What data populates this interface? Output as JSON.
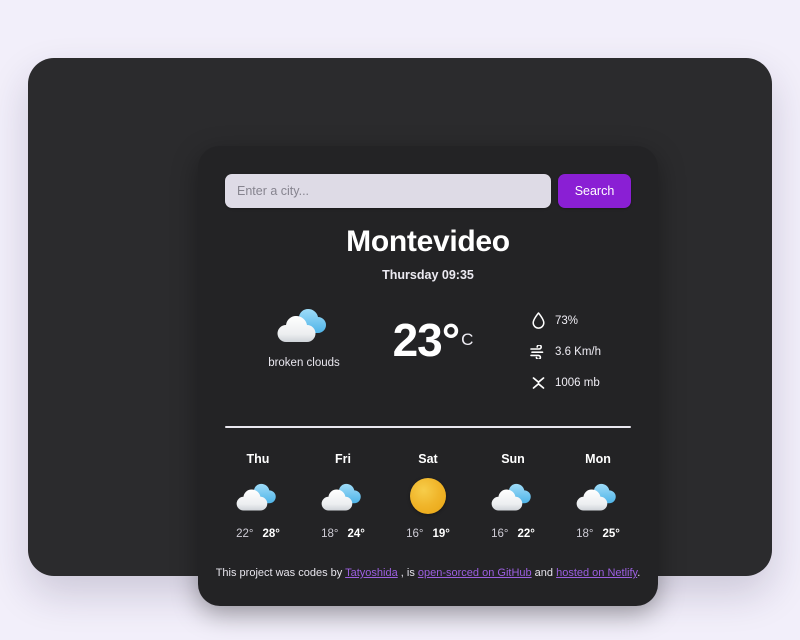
{
  "theme": {
    "page_background": "#f2effa",
    "outer_card": "#2b2b2d",
    "inner_card": "#232325",
    "accent_purple": "#8a1fd4",
    "link_purple": "#9c5fe0",
    "sun_yellow": "#f0b52a",
    "cloud_blue": "#7ec8f0",
    "text_primary": "#ffffff"
  },
  "search": {
    "placeholder": "Enter a city...",
    "value": "",
    "button_label": "Search"
  },
  "current": {
    "city": "Montevideo",
    "datetime": "Thursday 09:35",
    "icon": "broken-clouds-icon",
    "description": "broken clouds",
    "temperature": "23°",
    "unit": "C",
    "stats": [
      {
        "icon": "humidity-droplet-icon",
        "value": "73%"
      },
      {
        "icon": "wind-icon",
        "value": "3.6 Km/h"
      },
      {
        "icon": "pressure-icon",
        "value": "1006 mb"
      }
    ]
  },
  "forecast": [
    {
      "day": "Thu",
      "icon": "broken-clouds-icon",
      "min": "22°",
      "max": "28°"
    },
    {
      "day": "Fri",
      "icon": "broken-clouds-icon",
      "min": "18°",
      "max": "24°"
    },
    {
      "day": "Sat",
      "icon": "clear-sun-icon",
      "min": "16°",
      "max": "19°"
    },
    {
      "day": "Sun",
      "icon": "broken-clouds-icon",
      "min": "16°",
      "max": "22°"
    },
    {
      "day": "Mon",
      "icon": "broken-clouds-icon",
      "min": "18°",
      "max": "25°"
    }
  ],
  "footer": {
    "text_1": "This project was codes by ",
    "link_author": "Tatyoshida",
    "text_2": " , is ",
    "link_github": "open-sorced on GitHub",
    "text_3": " and ",
    "link_netlify": "hosted on Netlify",
    "text_4": "."
  }
}
